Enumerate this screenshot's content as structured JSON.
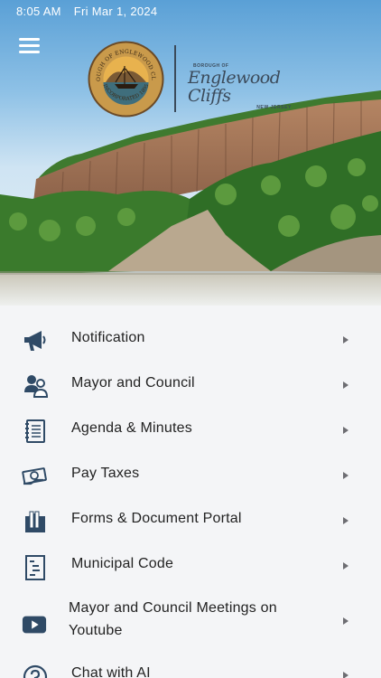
{
  "status_bar": {
    "time": "8:05 AM",
    "date": "Fri Mar 1, 2024"
  },
  "header": {
    "seal_text_top": "BOROUGH OF ENGLEWOOD CLIFFS",
    "seal_text_bottom": "INCORPORATED 1895",
    "wordmark_top": "BOROUGH OF",
    "wordmark_main": "Englewood Cliffs",
    "wordmark_bottom": "NEW JERSEY"
  },
  "menu": {
    "items": [
      {
        "label": "Notification",
        "icon": "megaphone-icon"
      },
      {
        "label": "Mayor and Council",
        "icon": "people-icon"
      },
      {
        "label": "Agenda & Minutes",
        "icon": "notebook-icon"
      },
      {
        "label": "Pay Taxes",
        "icon": "money-icon"
      },
      {
        "label": "Forms & Document Portal",
        "icon": "folder-icon"
      },
      {
        "label": "Municipal Code",
        "icon": "document-icon"
      },
      {
        "label": "Mayor and Council Meetings on Youtube",
        "icon": "youtube-icon"
      },
      {
        "label": "Chat with AI",
        "icon": "question-icon"
      }
    ]
  },
  "colors": {
    "icon": "#2f4a66",
    "text": "#222222",
    "chevron": "#6d6d72"
  }
}
